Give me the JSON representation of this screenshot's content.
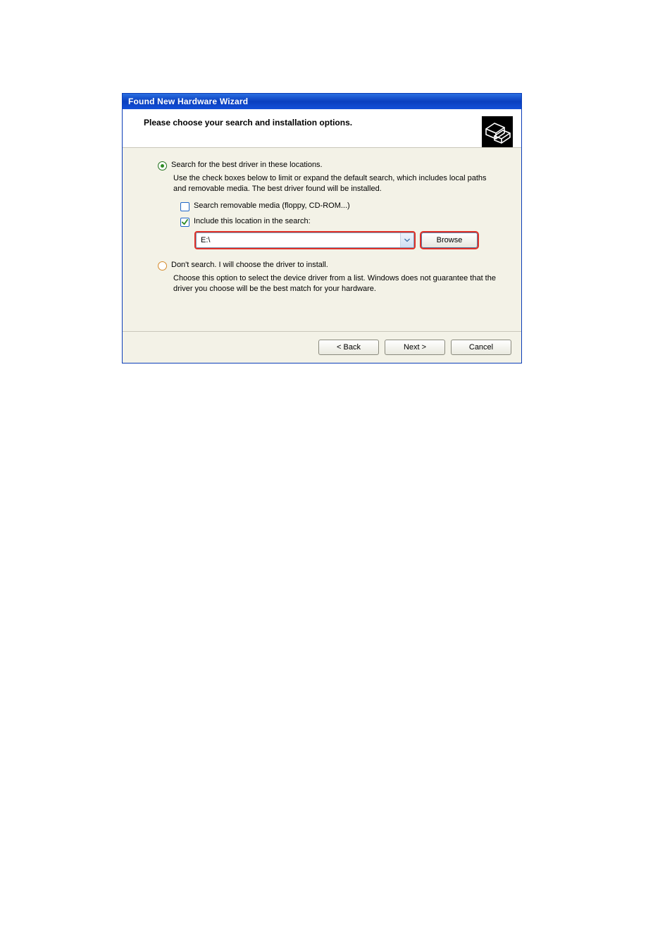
{
  "dialog": {
    "title": "Found New Hardware Wizard",
    "header": "Please choose your search and installation options."
  },
  "options": {
    "search": {
      "label": "Search for the best driver in these locations.",
      "desc": "Use the check boxes below to limit or expand the default search, which includes local paths and removable media. The best driver found will be installed.",
      "removable_label": "Search removable media (floppy, CD-ROM...)",
      "include_label": "Include this location in the search:",
      "path_value": "E:\\",
      "browse_label": "Browse",
      "selected": true,
      "removable_checked": false,
      "include_checked": true
    },
    "manual": {
      "label": "Don't search. I will choose the driver to install.",
      "desc": "Choose this option to select the device driver from a list.  Windows does not guarantee that the driver you choose will be the best match for your hardware."
    }
  },
  "buttons": {
    "back": "< Back",
    "next": "Next >",
    "cancel": "Cancel"
  }
}
